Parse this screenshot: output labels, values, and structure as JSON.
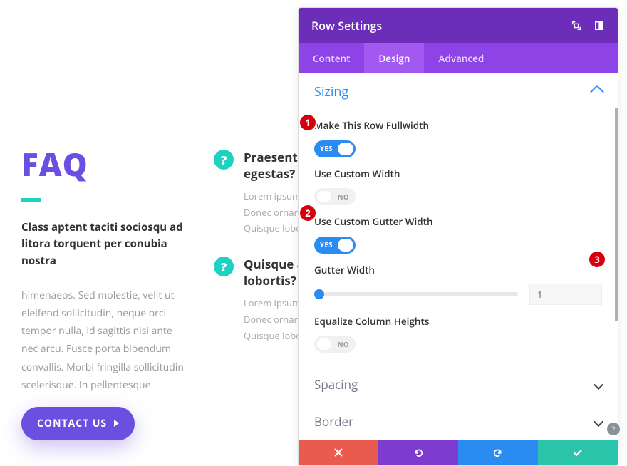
{
  "page": {
    "faq_title": "FAQ",
    "faq_sub": "Class aptent taciti sociosqu ad litora torquent per conubia nostra",
    "faq_body": "himenaeos. Sed molestie, velit ut eleifend sollicitudin, neque orci tempor nulla, id sagittis nisi ante nec arcu. Fusce porta bibendum convallis. Morbi fringilla sollicitudin scelerisque. In pellentesque",
    "contact_btn": "CONTACT US",
    "items": [
      {
        "q": "Praesent non",
        "q2": "egestas?",
        "a": "Lorem ipsum dolor consectetur adipis Donec ornare in nis imperdiet. Quisque lobortis at dapibus orci."
      },
      {
        "q": "Quisque ante",
        "q2": "lobortis?",
        "a": "Lorem ipsum dolor consectetur adipis Donec ornare in nis imperdiet. Quisque lobortis at dapibus orci."
      }
    ]
  },
  "modal": {
    "title": "Row Settings",
    "tabs": {
      "content": "Content",
      "design": "Design",
      "advanced": "Advanced"
    },
    "sizing": {
      "title": "Sizing",
      "fullwidth": {
        "label": "Make This Row Fullwidth",
        "state_text": "YES"
      },
      "custom_width": {
        "label": "Use Custom Width",
        "state_text": "NO"
      },
      "custom_gutter": {
        "label": "Use Custom Gutter Width",
        "state_text": "YES"
      },
      "gutter": {
        "label": "Gutter Width",
        "value": "1"
      },
      "equalize": {
        "label": "Equalize Column Heights",
        "state_text": "NO"
      }
    },
    "spacing_title": "Spacing",
    "border_title": "Border"
  },
  "callouts": {
    "one": "1",
    "two": "2",
    "three": "3"
  }
}
